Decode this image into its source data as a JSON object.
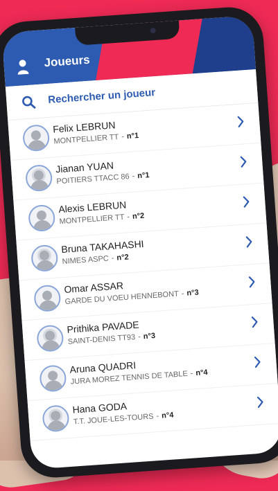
{
  "header": {
    "title": "Joueurs",
    "icons": {
      "user": "user-icon"
    },
    "colors": {
      "primary": "#2d5bb2",
      "accent": "#ee2a55",
      "dark_blue": "#1f3f8c"
    }
  },
  "search": {
    "placeholder": "Rechercher un joueur",
    "icon": "search-icon"
  },
  "players": [
    {
      "name": "Felix LEBRUN",
      "club": "MONTPELLIER TT",
      "rank": "n°1",
      "avatar": "male"
    },
    {
      "name": "Jianan YUAN",
      "club": "POITIERS TTACC 86",
      "rank": "n°1",
      "avatar": "female"
    },
    {
      "name": "Alexis LEBRUN",
      "club": "MONTPELLIER TT",
      "rank": "n°2",
      "avatar": "male"
    },
    {
      "name": "Bruna TAKAHASHI",
      "club": "NIMES ASPC",
      "rank": "n°2",
      "avatar": "female"
    },
    {
      "name": "Omar ASSAR",
      "club": "GARDE DU VOEU HENNEBONT",
      "rank": "n°3",
      "avatar": "male"
    },
    {
      "name": "Prithika PAVADE",
      "club": "SAINT-DENIS TT93",
      "rank": "n°3",
      "avatar": "female"
    },
    {
      "name": "Aruna QUADRI",
      "club": "JURA MOREZ TENNIS DE TABLE",
      "rank": "n°4",
      "avatar": "male"
    },
    {
      "name": "Hana GODA",
      "club": "T.T. JOUE-LES-TOURS",
      "rank": "n°4",
      "avatar": "female"
    }
  ],
  "row_separator": "-"
}
